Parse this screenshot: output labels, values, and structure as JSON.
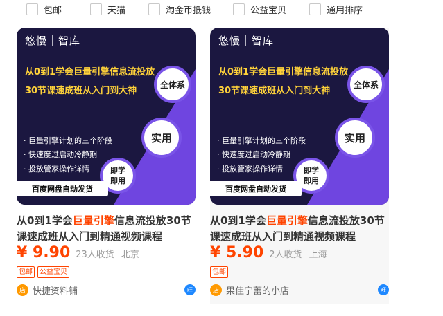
{
  "filters": [
    {
      "label": "包邮",
      "checked": false
    },
    {
      "label": "天猫",
      "checked": false
    },
    {
      "label": "淘金币抵钱",
      "checked": false
    },
    {
      "label": "公益宝贝",
      "checked": false
    },
    {
      "label": "通用排序",
      "checked": false
    }
  ],
  "products": [
    {
      "banner": {
        "brand": "悠慢｜智库",
        "headline1": "从0到1学会巨量引擎信息流投放",
        "headline2": "30节课速成班从入门到大神",
        "badge_full": "全体系",
        "badge_use": "实用",
        "badge_now": "即学即用",
        "bullets": [
          "· 巨量引擎计划的三个阶段",
          "· 快速度过启动冷静期",
          "· 投放管家操作详情"
        ],
        "ship": "百度网盘自动发货"
      },
      "title_pre": "从0到1学会",
      "title_hl": "巨量引擎",
      "title_post": "信息流投放30节课速成班从入门到精通视频课程",
      "price": "¥ 9.90",
      "sales": "23人收货",
      "location": "北京",
      "tags": [
        "包邮",
        "公益宝贝"
      ],
      "shop_name": "快捷资料铺",
      "shop_icon": "店",
      "ww_icon": "旺"
    },
    {
      "banner": {
        "brand": "悠慢｜智库",
        "headline1": "从0到1学会巨量引擎信息流投放",
        "headline2": "30节课速成班从入门到大神",
        "badge_full": "全体系",
        "badge_use": "实用",
        "badge_now": "即学即用",
        "bullets": [
          "· 巨量引擎计划的三个阶段",
          "· 快速度过启动冷静期",
          "· 投放管家操作详情"
        ],
        "ship": "百度网盘自动发货"
      },
      "title_pre": "从0到1学会",
      "title_hl": "巨量引擎",
      "title_post": "信息流投放30节课速成班从入门到精通视频课程",
      "price": "¥ 5.90",
      "sales": "2人收货",
      "location": "上海",
      "tags": [
        "包邮"
      ],
      "shop_name": "果佳宁蕾的小店",
      "shop_icon": "店",
      "ww_icon": "旺"
    }
  ],
  "colors": {
    "accent": "#ff4400",
    "banner_bg": "#1b1740",
    "banner_purple": "#6f45e0",
    "headline": "#ffd23a"
  }
}
